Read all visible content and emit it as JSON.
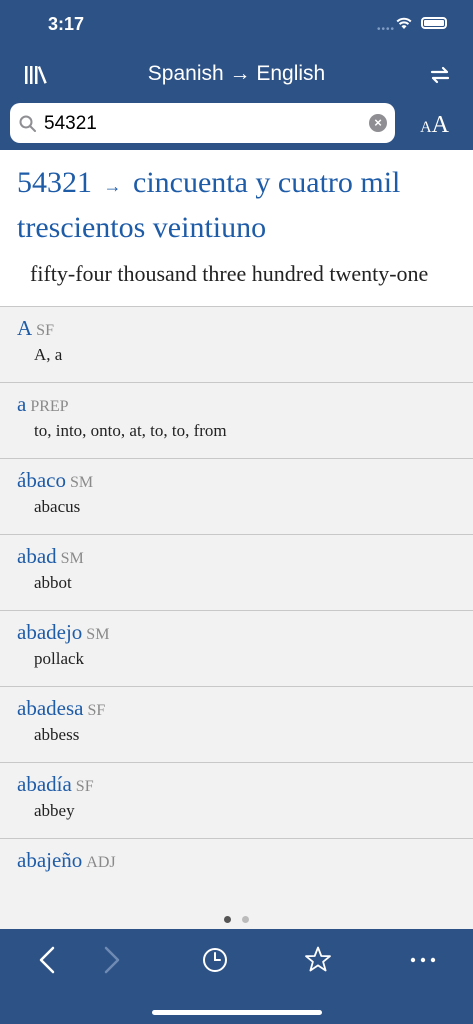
{
  "status": {
    "time": "3:17",
    "signal": "••••"
  },
  "nav": {
    "title": "Spanish → English"
  },
  "search": {
    "value": "54321"
  },
  "fontsize": {
    "small": "A",
    "large": "A"
  },
  "number_result": {
    "number": "54321",
    "arrow": "→",
    "spanish": "cincuenta y cuatro mil trescientos veintiuno",
    "english": "fifty-four thousand three hundred twenty-one"
  },
  "entries": [
    {
      "headword": "A",
      "pos": "SF",
      "definition": "A, a"
    },
    {
      "headword": "a",
      "pos": "PREP",
      "definition": "to, into, onto, at, to, to, from"
    },
    {
      "headword": "ábaco",
      "pos": "SM",
      "definition": "abacus"
    },
    {
      "headword": "abad",
      "pos": "SM",
      "definition": "abbot"
    },
    {
      "headword": "abadejo",
      "pos": "SM",
      "definition": "pollack"
    },
    {
      "headword": "abadesa",
      "pos": "SF",
      "definition": "abbess"
    },
    {
      "headword": "abadía",
      "pos": "SF",
      "definition": "abbey"
    },
    {
      "headword": "abajeño",
      "pos": "ADJ",
      "definition": ""
    }
  ],
  "colors": {
    "accent": "#2d5286",
    "link": "#1f5ca8"
  }
}
